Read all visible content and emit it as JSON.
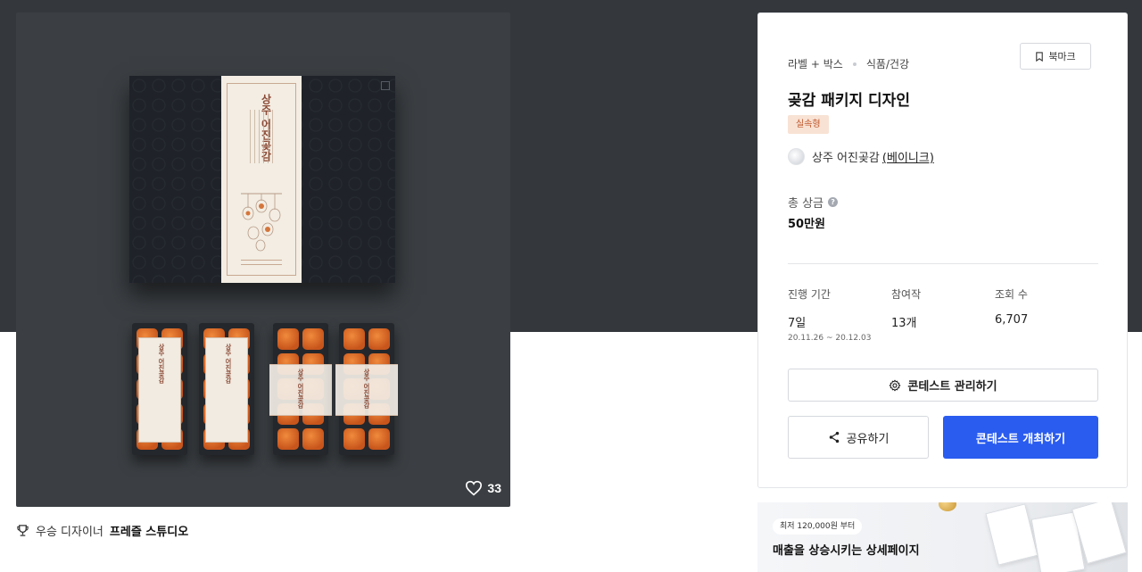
{
  "hero": {
    "label_title": "상주 어진곶감",
    "tray_label": "상주 어진곶감",
    "like_count": "33"
  },
  "award": {
    "prefix": "우승 디자이너",
    "designer": "프레즐 스튜디오"
  },
  "card": {
    "category": "라벨 + 박스",
    "subcategory": "식품/건강",
    "bookmark_label": "북마크",
    "title": "곶감 패키지 디자인",
    "badge": "실속형",
    "host_name": "상주 어진곶감",
    "host_link": "(베이니크)",
    "prize_label": "총 상금",
    "prize_help": "?",
    "prize_value": "50만원",
    "stats": [
      {
        "label": "진행 기간",
        "value": "7일",
        "sub": "20.11.26 ~ 20.12.03"
      },
      {
        "label": "참여작",
        "value": "13개",
        "sub": ""
      },
      {
        "label": "조회 수",
        "value": "6,707",
        "sub": ""
      }
    ],
    "manage_label": "콘테스트 관리하기",
    "share_label": "공유하기",
    "host_contest_label": "콘테스트 개최하기"
  },
  "ad": {
    "chip": "최저 120,000원 부터",
    "title": "매출을 상승시키는 상세페이지"
  },
  "colors": {
    "top_band": "#34383d",
    "primary": "#2a5cf0",
    "badge_bg": "#f8e2d4",
    "badge_text": "#c0582c"
  },
  "icons": [
    "heart-icon",
    "trophy-icon",
    "bookmark-icon",
    "help-icon",
    "gear-icon",
    "share-icon"
  ]
}
